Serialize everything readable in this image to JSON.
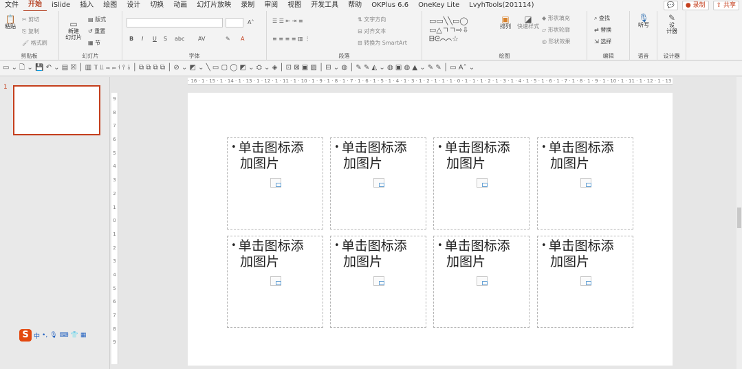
{
  "menu": {
    "items": [
      "文件",
      "开始",
      "iSlide",
      "插入",
      "绘图",
      "设计",
      "切换",
      "动画",
      "幻灯片放映",
      "录制",
      "审阅",
      "视图",
      "开发工具",
      "帮助",
      "OKPlus 6.6",
      "OneKey Lite",
      "LvyhTools(201114)"
    ],
    "active": "开始",
    "record_label": "● 录制",
    "share_label": "共享"
  },
  "ribbon": {
    "clipboard": {
      "label": "剪贴板",
      "paste": "粘贴",
      "cut": "✂ 剪切",
      "copy": "复制",
      "format_painter": "格式刷"
    },
    "slides": {
      "label": "幻灯片",
      "new_slide": "新建\n幻灯片",
      "layout": "版式",
      "reset": "重置",
      "section": "节"
    },
    "font": {
      "label": "字体",
      "bold": "B",
      "italic": "I",
      "underline": "U",
      "strike": "S",
      "shadow": "abc"
    },
    "paragraph": {
      "label": "段落",
      "text_direction": "文字方向",
      "align_text": "对齐文本",
      "smartart": "转换为 SmartArt"
    },
    "drawing": {
      "label": "绘图",
      "arrange": "排列",
      "quick_styles": "快速样式",
      "shape_fill": "形状填充",
      "shape_outline": "形状轮廓",
      "shape_effects": "形状效果"
    },
    "editing": {
      "label": "编辑",
      "find": "查找",
      "replace": "替换",
      "select": "选择"
    },
    "voice": {
      "label": "语音",
      "dictate": "听写"
    },
    "designer": {
      "label": "设计器",
      "designer_btn": "设\n计器"
    }
  },
  "thumbnails": {
    "slide_number": "1"
  },
  "ruler": {
    "horizontal": "· 16 · 1 · 15 · 1 · 14 · 1 · 13 · 1 · 12 · 1 · 11 · 1 · 10 · 1 · 9 · 1 · 8 · 1 · 7 · 1 · 6 · 1 · 5 · 1 · 4 · 1 · 3 · 1 · 2 · 1 · 1 · 1 · 0 · 1 · 1 · 1 · 2 · 1 · 3 · 1 · 4 · 1 · 5 · 1 · 6 · 1 · 7 · 1 · 8 · 1 · 9 · 1 · 10 · 1 · 11 · 1 · 12 · 1 · 13 · 1 · 14 · 1 · 15 · 1 · 16 ·",
    "vertical": [
      "9",
      "8",
      "7",
      "6",
      "5",
      "4",
      "3",
      "2",
      "1",
      "0",
      "1",
      "2",
      "3",
      "4",
      "5",
      "6",
      "7",
      "8",
      "9"
    ]
  },
  "placeholders": [
    {
      "line1": "单击图标添",
      "line2": "加图片"
    },
    {
      "line1": "单击图标添",
      "line2": "加图片"
    },
    {
      "line1": "单击图标添",
      "line2": "加图片"
    },
    {
      "line1": "单击图标添",
      "line2": "加图片"
    },
    {
      "line1": "单击图标添",
      "line2": "加图片"
    },
    {
      "line1": "单击图标添",
      "line2": "加图片"
    },
    {
      "line1": "单击图标添",
      "line2": "加图片"
    },
    {
      "line1": "单击图标添",
      "line2": "加图片"
    }
  ],
  "ime": {
    "mode": "中"
  },
  "colors": {
    "accent": "#c43e1c",
    "placeholder_border": "#b5b5b5"
  }
}
